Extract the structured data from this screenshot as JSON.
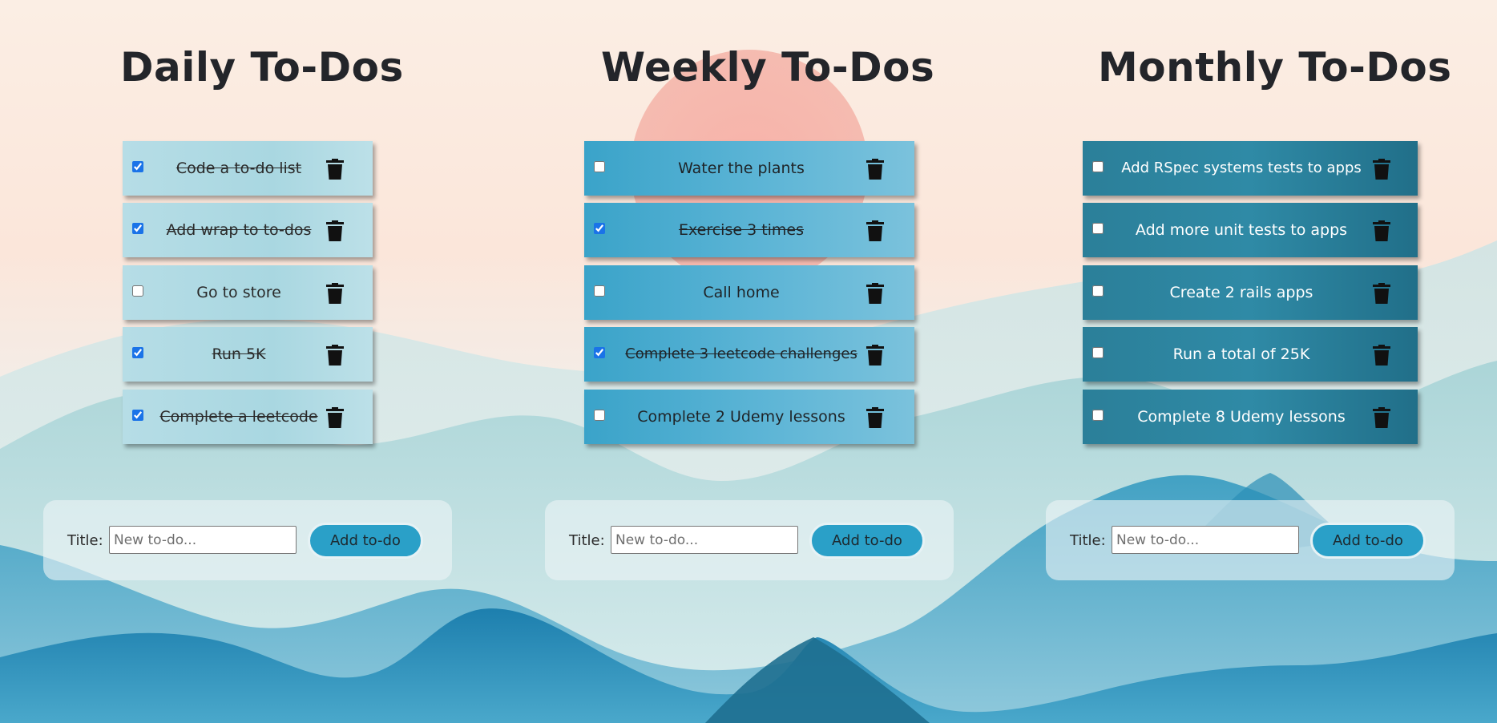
{
  "colors": {
    "daily_item": "#b6dde6",
    "weekly_item": "#4aabcf",
    "monthly_item": "#2a7e98",
    "button": "#2aa0c8",
    "title": "#23252a"
  },
  "icons": {
    "delete": "trash-icon"
  },
  "columns": [
    {
      "title": "Daily To-Dos",
      "items": [
        {
          "text": "Code a to-do list",
          "checked": true
        },
        {
          "text": "Add wrap to to-dos",
          "checked": true
        },
        {
          "text": "Go to store",
          "checked": false
        },
        {
          "text": "Run 5K",
          "checked": true
        },
        {
          "text": "Complete a leetcode",
          "checked": true
        }
      ],
      "form": {
        "label": "Title:",
        "placeholder": "New to-do...",
        "button": "Add to-do"
      }
    },
    {
      "title": "Weekly To-Dos",
      "items": [
        {
          "text": "Water the plants",
          "checked": false
        },
        {
          "text": "Exercise 3 times",
          "checked": true
        },
        {
          "text": "Call home",
          "checked": false
        },
        {
          "text": "Complete 3 leetcode challenges",
          "checked": true
        },
        {
          "text": "Complete 2 Udemy lessons",
          "checked": false
        }
      ],
      "form": {
        "label": "Title:",
        "placeholder": "New to-do...",
        "button": "Add to-do"
      }
    },
    {
      "title": "Monthly To-Dos",
      "items": [
        {
          "text": "Add RSpec systems tests to apps",
          "checked": false
        },
        {
          "text": "Add more unit tests to apps",
          "checked": false
        },
        {
          "text": "Create 2 rails apps",
          "checked": false
        },
        {
          "text": "Run a total of 25K",
          "checked": false
        },
        {
          "text": "Complete 8 Udemy lessons",
          "checked": false
        }
      ],
      "form": {
        "label": "Title:",
        "placeholder": "New to-do...",
        "button": "Add to-do"
      }
    }
  ]
}
